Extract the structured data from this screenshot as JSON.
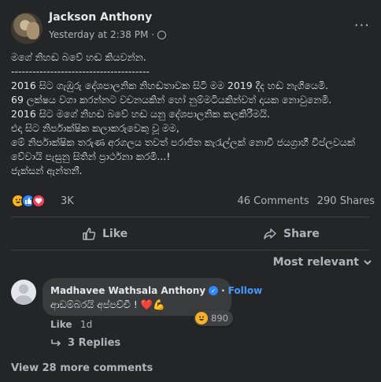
{
  "post": {
    "author": "Jackson Anthony",
    "timestamp": "Yesterday at 2:38 PM",
    "separator": "·",
    "more_icon": "···",
    "body_lines": [
      "මගේ නිහඬ බවේ හඬ කියවන්න.",
      "---------------------------------------",
      "2016 සිට ගැඹුරු දේශපාලනික නිහඬතාවක සිටි මම 2019 දීද හඬ නැගියෙමි.",
      "69 ලක්ෂය වගා කරන්නට වචනයකින් හෝ නුම්මටියකින්වත් දායක නොවුනෙමි.",
      "2016 සිට මගේ නිහඬ බවේ හඬ යනු දේශපාලනික කලකිරීමයි.",
      "එදා සිට නිර්පාක්ෂික කලාකරුවෙකු වූ මම,",
      "මේ නිර්පාක්ෂික තරුණ අරගලය තවත් පරාජිත කැරැල්ලක් නොවී ජයග්‍රාහී විප්ලවයක්",
      "වේවායි පැසුනු සිතින් ප්‍රාර්ථනා කරමි...!",
      "ජැක්සන් ඇන්තනී."
    ],
    "reaction_count": "3K",
    "comments_count": "46 Comments",
    "shares_count": "290 Shares",
    "colors": {
      "like": "#2d88ff",
      "love": "#f33e58",
      "haha": "#f7b125",
      "link": "#4599ff"
    }
  },
  "actions": {
    "like_label": "Like",
    "share_label": "Share"
  },
  "comments_header": {
    "sort_label": "Most relevant"
  },
  "comment": {
    "author": "Madhavee Wathsala Anthony",
    "follow_label": "Follow",
    "follow_separator": "·",
    "text": "ආඩම්බරයි අප්පච්චී !",
    "emojis": "❤️💪",
    "reaction_count": "890",
    "like_label": "Like",
    "time": "1d",
    "replies_label": "3 Replies"
  },
  "footer": {
    "view_more_label": "View 28 more comments"
  }
}
